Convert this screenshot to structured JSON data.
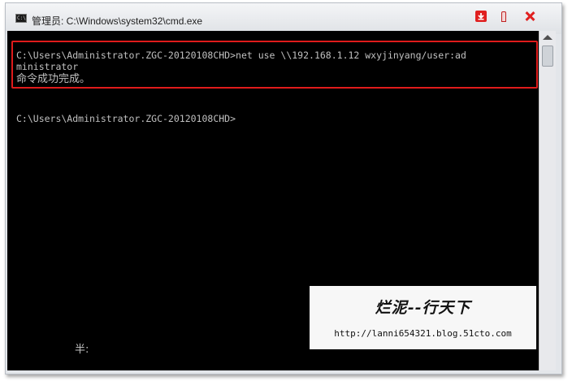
{
  "window": {
    "title": "管理员: C:\\Windows\\system32\\cmd.exe",
    "app_icon": "cmd-icon",
    "controls": [
      "download-icon",
      "pin-icon",
      "close-icon"
    ]
  },
  "console": {
    "lines": [
      "C:\\Users\\Administrator.ZGC-20120108CHD>net use \\\\192.168.1.12 wxyjinyang/user:ad",
      "ministrator",
      "命令成功完成。",
      "C:\\Users\\Administrator.ZGC-20120108CHD>",
      "半:"
    ]
  },
  "watermark": {
    "title": "烂泥--行天下",
    "url": "http://lanni654321.blog.51cto.com"
  },
  "colors": {
    "console_background": "#000000",
    "console_text": "#c0c0c0",
    "highlight_border": "#e01b1b"
  }
}
